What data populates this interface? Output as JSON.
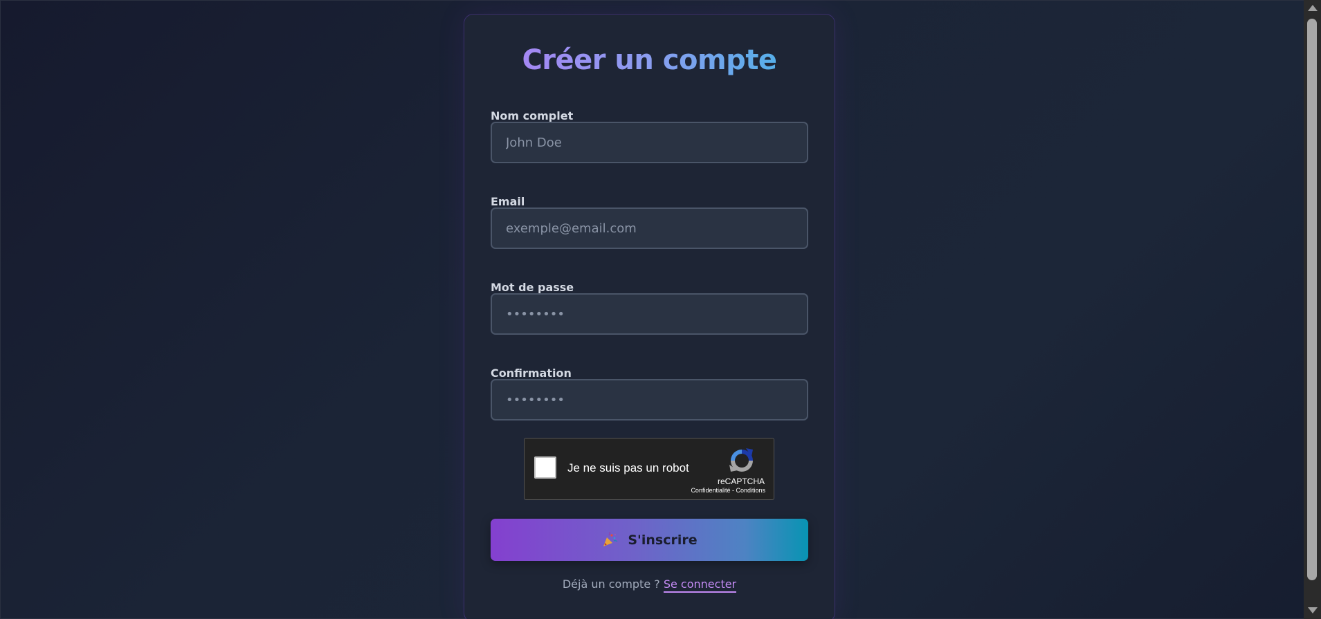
{
  "form": {
    "title": "Créer un compte",
    "fields": [
      {
        "label": "Nom complet",
        "placeholder": "John Doe",
        "type": "text"
      },
      {
        "label": "Email",
        "placeholder": "exemple@email.com",
        "type": "email"
      },
      {
        "label": "Mot de passe",
        "placeholder": "••••••••",
        "type": "password"
      },
      {
        "label": "Confirmation",
        "placeholder": "••••••••",
        "type": "password"
      }
    ],
    "submit": {
      "label": "S'inscrire",
      "icon": "party-popper-icon"
    },
    "footer": {
      "text": "Déjà un compte ?",
      "link_label": "Se connecter"
    }
  },
  "recaptcha": {
    "label": "Je ne suis pas un robot",
    "brand": "reCAPTCHA",
    "links": "Confidentialité - Conditions",
    "checked": false
  },
  "colors": {
    "title_gradient_start": "#b07ef5",
    "title_gradient_end": "#3fb7e6",
    "button_gradient_start": "#8440cf",
    "button_gradient_end": "#0894b3",
    "link": "#c58bf5"
  }
}
